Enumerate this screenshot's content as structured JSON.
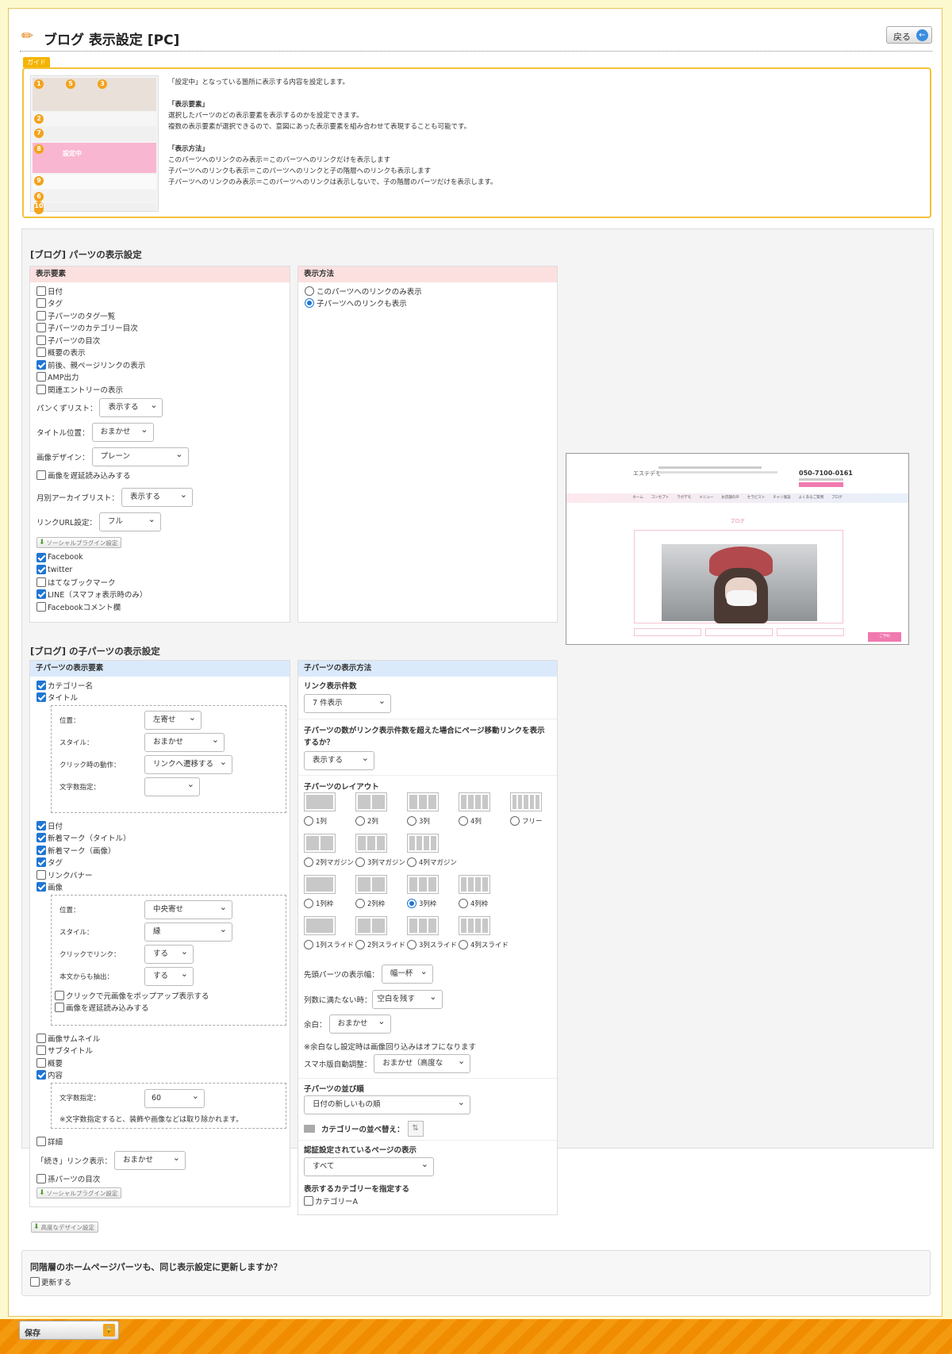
{
  "header": {
    "title": "ブログ 表示設定 [PC]",
    "back_label": "戻る"
  },
  "guide": {
    "tag": "ガイド",
    "thumb_setting": "設定中",
    "thumb_numbers": [
      "1",
      "2",
      "3",
      "4",
      "5",
      "6",
      "7",
      "8",
      "9",
      "10"
    ],
    "lines": [
      "「設定中」となっている箇所に表示する内容を設定します。",
      "",
      "「表示要素」",
      "選択したパーツのどの表示要素を表示するのかを設定できます。",
      "複数の表示要素が選択できるので、意図にあった表示要素を組み合わせて表現することも可能です。",
      "",
      "「表示方法」",
      "このパーツへのリンクのみ表示＝このパーツへのリンクだけを表示します",
      "子パーツへのリンクも表示＝このパーツへのリンクと子の階層へのリンクも表示します",
      "子パーツへのリンクのみ表示＝このパーツへのリンクは表示しないで、子の階層のパーツだけを表示します。"
    ]
  },
  "parts": {
    "title": "[ブログ] パーツの表示設定",
    "elements_header": "表示要素",
    "checks": [
      {
        "label": "日付",
        "checked": false
      },
      {
        "label": "タグ",
        "checked": false
      },
      {
        "label": "子パーツのタグ一覧",
        "checked": false
      },
      {
        "label": "子パーツのカテゴリー目次",
        "checked": false
      },
      {
        "label": "子パーツの目次",
        "checked": false
      },
      {
        "label": "概要の表示",
        "checked": false
      },
      {
        "label": "前後、親ページリンクの表示",
        "checked": true
      },
      {
        "label": "AMP出力",
        "checked": false
      },
      {
        "label": "関連エントリーの表示",
        "checked": false
      }
    ],
    "breadcrumb_label": "パンくずリスト：",
    "breadcrumb_value": "表示する",
    "title_pos_label": "タイトル位置：",
    "title_pos_value": "おまかせ",
    "image_design_label": "画像デザイン：",
    "image_design_value": "プレーン",
    "lazy_label": "画像を遅延読み込みする",
    "archive_label": "月別アーカイブリスト：",
    "archive_value": "表示する",
    "link_url_label": "リンクURL設定：",
    "link_url_value": "フル",
    "social_btn": "ソーシャルプラグイン設定",
    "social": [
      {
        "label": "Facebook",
        "checked": true
      },
      {
        "label": "twitter",
        "checked": true
      },
      {
        "label": "はてなブックマーク",
        "checked": false
      },
      {
        "label": "LINE（スマフォ表示時のみ）",
        "checked": true
      },
      {
        "label": "Facebookコメント欄",
        "checked": false
      }
    ],
    "method_header": "表示方法",
    "methods": [
      {
        "label": "このパーツへのリンクのみ表示",
        "checked": false
      },
      {
        "label": "子パーツへのリンクも表示",
        "checked": true
      }
    ]
  },
  "preview": {
    "site_name": "エステデモ",
    "phone": "050-7100-0161",
    "nav": [
      "ホーム",
      "コンセプト",
      "ラボデモ",
      "メニュー",
      "お店舗の声",
      "セラピスト",
      "チャン施設",
      "よくあるご質問",
      "ブログ"
    ],
    "heading": "ブログ",
    "button": "ご予約"
  },
  "child": {
    "title": "[ブログ] の子パーツの表示設定",
    "elements_header": "子パーツの表示要素",
    "checks_top": [
      {
        "label": "カテゴリー名",
        "checked": true
      },
      {
        "label": "タイトル",
        "checked": true
      }
    ],
    "title_opts": [
      {
        "label": "位置：",
        "value": "左寄せ"
      },
      {
        "label": "スタイル：",
        "value": "おまかせ"
      },
      {
        "label": "クリック時の動作：",
        "value": "リンクへ遷移する"
      },
      {
        "label": "文字数指定：",
        "value": ""
      }
    ],
    "checks_mid": [
      {
        "label": "日付",
        "checked": true
      },
      {
        "label": "新着マーク（タイトル）",
        "checked": true
      },
      {
        "label": "新着マーク（画像）",
        "checked": true
      },
      {
        "label": "タグ",
        "checked": true
      },
      {
        "label": "リンクバナー",
        "checked": false
      },
      {
        "label": "画像",
        "checked": true
      }
    ],
    "image_opts": [
      {
        "label": "位置：",
        "value": "中央寄せ"
      },
      {
        "label": "スタイル：",
        "value": "縁"
      },
      {
        "label": "クリックでリンク：",
        "value": "する"
      },
      {
        "label": "本文からも抽出：",
        "value": "する"
      }
    ],
    "image_checks": [
      {
        "label": "クリックで元画像をポップアップ表示する",
        "checked": false
      },
      {
        "label": "画像を遅延読み込みする",
        "checked": false
      }
    ],
    "checks_low": [
      {
        "label": "画像サムネイル",
        "checked": false
      },
      {
        "label": "サブタイトル",
        "checked": false
      },
      {
        "label": "概要",
        "checked": false
      },
      {
        "label": "内容",
        "checked": true
      }
    ],
    "content_len_label": "文字数指定：",
    "content_len_value": "60",
    "content_note": "※文字数指定すると、装飾や画像などは取り除かれます。",
    "detail_label": "詳細",
    "more_label": "「続き」リンク表示：",
    "more_value": "おまかせ",
    "grandchild_label": "孫パーツの目次",
    "social_btn": "ソーシャルプラグイン設定",
    "method_header": "子パーツの表示方法",
    "link_count_title": "リンク表示件数",
    "link_count_value": "7 件表示",
    "paging_title": "子パーツの数がリンク表示件数を超えた場合にページ移動リンクを表示するか？",
    "paging_value": "表示する",
    "layout_title": "子パーツのレイアウト",
    "layout_rows": [
      [
        {
          "label": "1列",
          "cols": 1
        },
        {
          "label": "2列",
          "cols": 2
        },
        {
          "label": "3列",
          "cols": 3
        },
        {
          "label": "4列",
          "cols": 4
        },
        {
          "label": "フリー",
          "cols": 5
        }
      ],
      [
        {
          "label": "2列マガジン",
          "cols": 2
        },
        {
          "label": "3列マガジン",
          "cols": 3
        },
        {
          "label": "4列マガジン",
          "cols": 4
        }
      ],
      [
        {
          "label": "1列枠",
          "cols": 1
        },
        {
          "label": "2列枠",
          "cols": 2
        },
        {
          "label": "3列枠",
          "cols": 3,
          "checked": true
        },
        {
          "label": "4列枠",
          "cols": 4
        }
      ],
      [
        {
          "label": "1列スライド",
          "cols": 1
        },
        {
          "label": "2列スライド",
          "cols": 2
        },
        {
          "label": "3列スライド",
          "cols": 3
        },
        {
          "label": "4列スライド",
          "cols": 4
        }
      ]
    ],
    "lead_width_label": "先頭パーツの表示幅：",
    "lead_width_value": "幅一杯",
    "shortfall_label": "列数に満たない時：",
    "shortfall_value": "空白を残す",
    "margin_label": "余白：",
    "margin_value": "おまかせ",
    "margin_note": "※余白なし設定時は画像回り込みはオフになります",
    "sp_label": "スマホ版自動調整：",
    "sp_value": "おまかせ（高度な",
    "order_title": "子パーツの並び順",
    "order_value": "日付の新しいもの順",
    "category_sort_label": "カテゴリーの並べ替え：",
    "auth_title": "認証設定されているページの表示",
    "auth_value": "すべて",
    "cat_title": "表示するカテゴリーを指定する",
    "cat_checks": [
      {
        "label": "カテゴリーA",
        "checked": false
      }
    ]
  },
  "advanced_btn": "高度なデザイン設定",
  "sync": {
    "question": "同階層のホームページパーツも、同じ表示設定に更新しますか？",
    "check_label": "更新する"
  },
  "save_label": "保存"
}
